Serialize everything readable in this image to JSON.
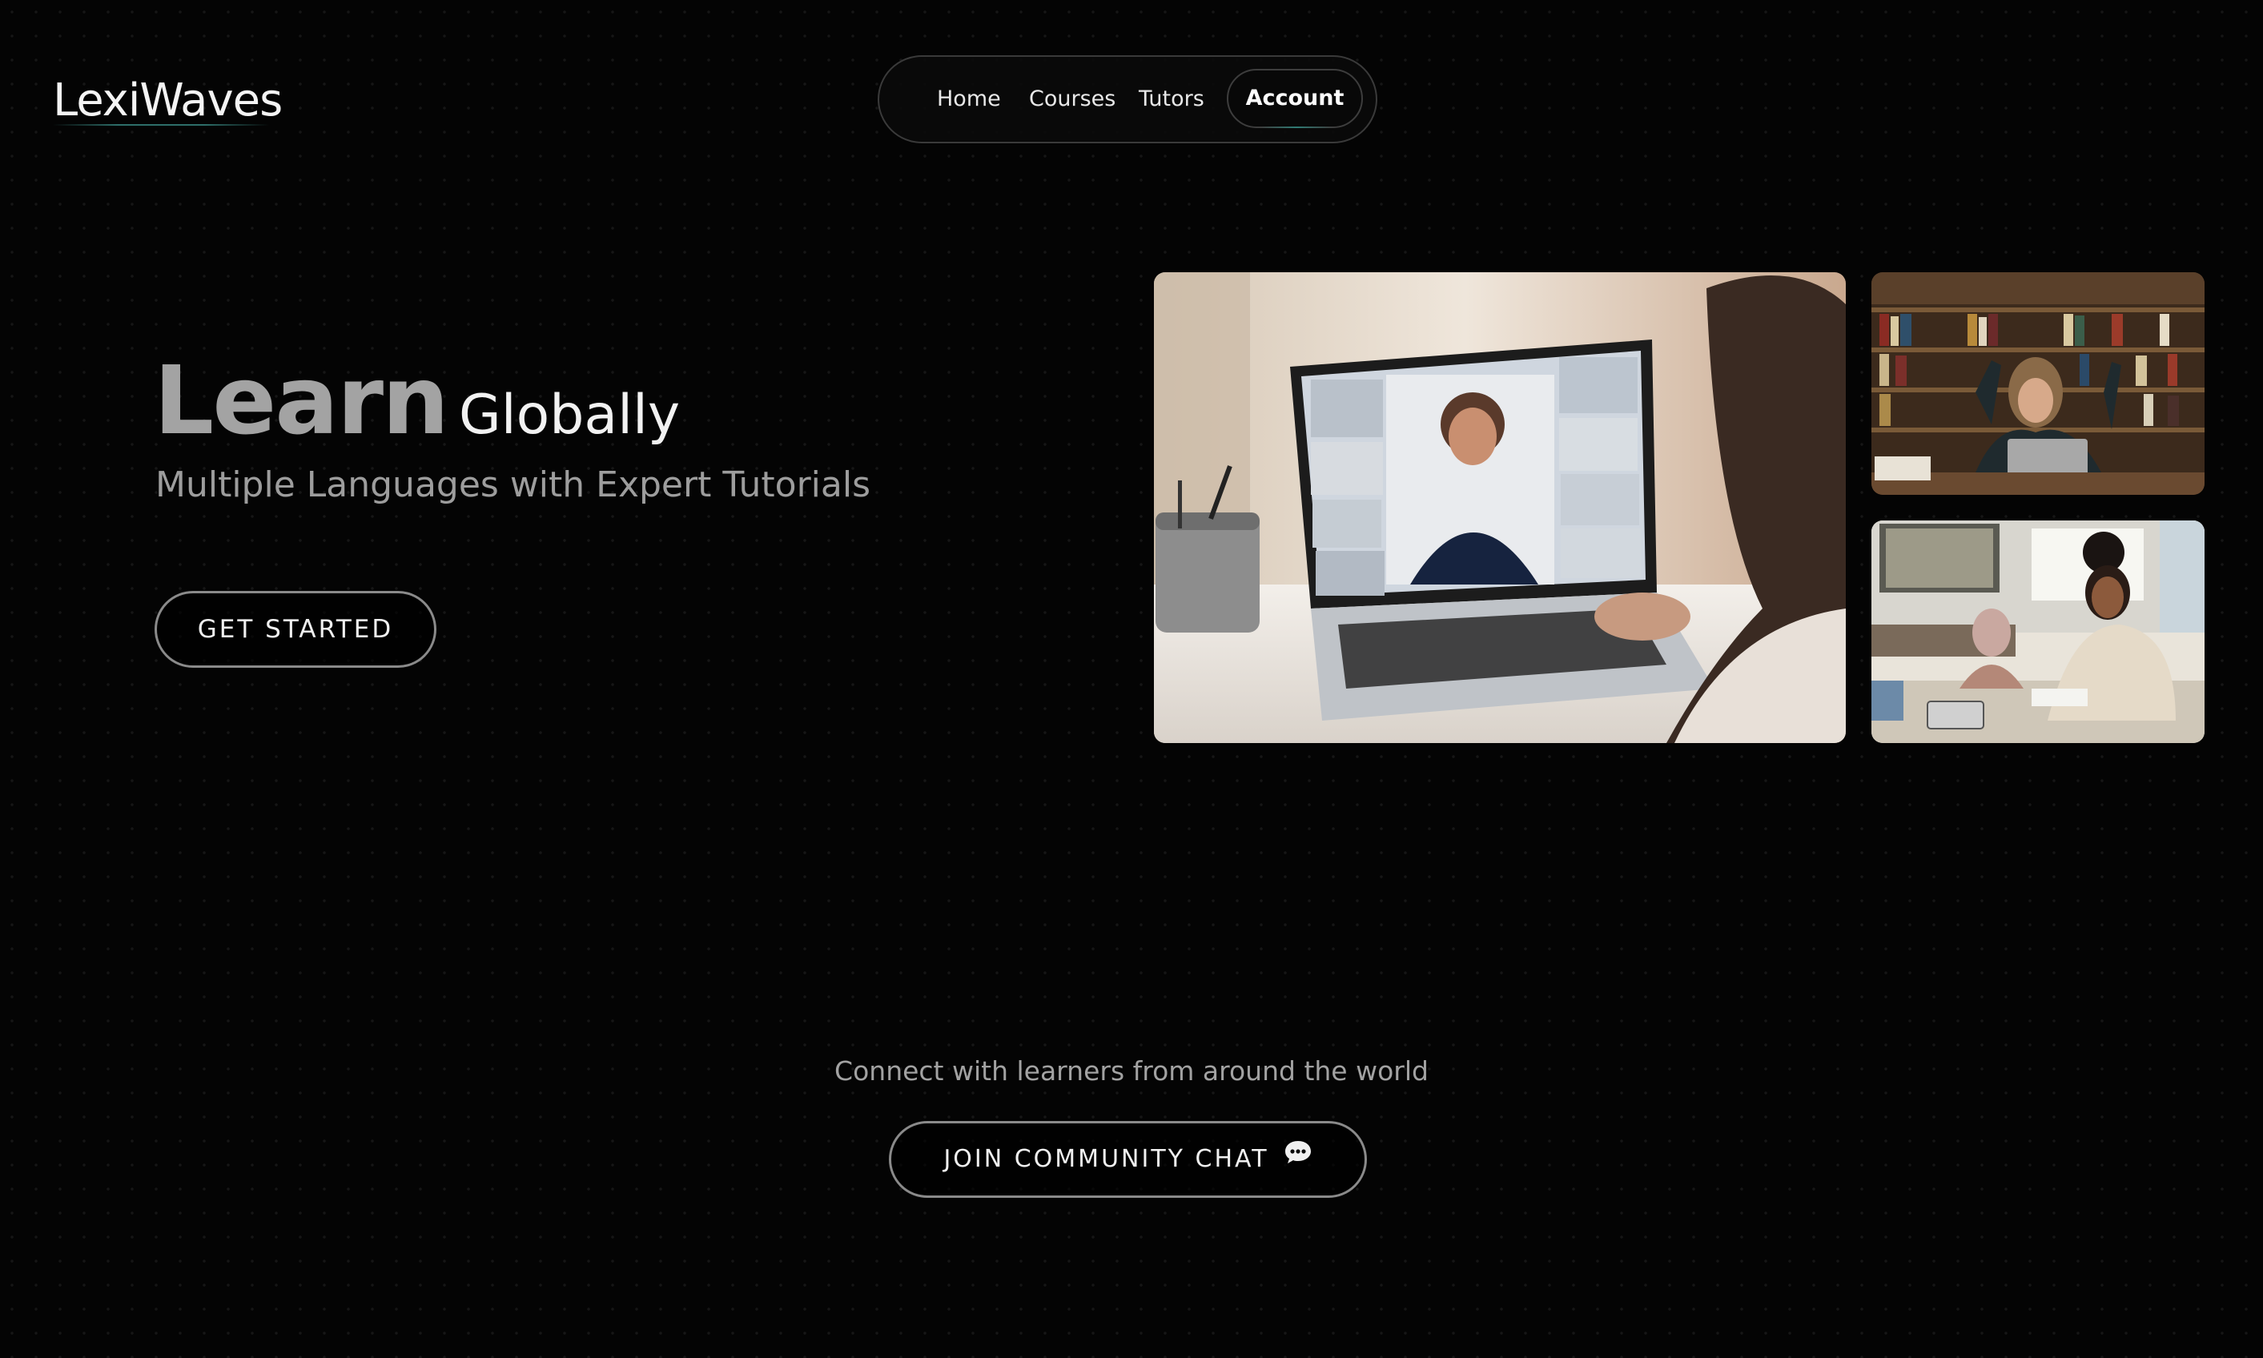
{
  "brand": {
    "name": "LexiWaves"
  },
  "nav": {
    "items": [
      {
        "label": "Home"
      },
      {
        "label": "Courses"
      },
      {
        "label": "Tutors"
      }
    ],
    "account_label": "Account"
  },
  "hero": {
    "title_strong": "Learn",
    "title_light": "Globally",
    "subtitle": "Multiple Languages with Expert Tutorials",
    "cta_label": "GET STARTED"
  },
  "gallery": {
    "images": [
      {
        "icon": "video-call-laptop-photo"
      },
      {
        "icon": "student-library-celebrating-photo"
      },
      {
        "icon": "classroom-student-writing-photo"
      }
    ]
  },
  "community": {
    "text": "Connect with learners from around the world",
    "button_label": "JOIN COMMUNITY CHAT",
    "button_icon": "chat-bubble-icon"
  },
  "colors": {
    "background": "#040404",
    "accent": "#2e6f6a",
    "text_muted": "#a3a3a3"
  }
}
